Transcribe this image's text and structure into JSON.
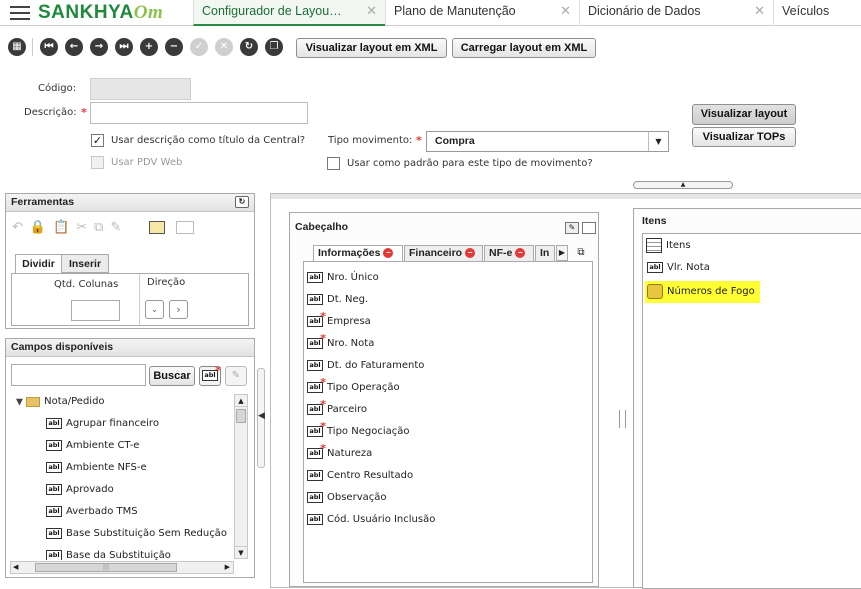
{
  "app": {
    "logo_text": "SANKHYA",
    "logo_suffix": "Om",
    "brand_color": "#1f8a3a"
  },
  "tabs": [
    {
      "label": "Configurador de Layou…",
      "active": true
    },
    {
      "label": "Plano de Manutenção"
    },
    {
      "label": "Dicionário de Dados"
    },
    {
      "label": "Veículos"
    }
  ],
  "toolbar": {
    "xml_view_label": "Visualizar layout em XML",
    "xml_load_label": "Carregar layout em XML"
  },
  "form": {
    "codigo_label": "Código:",
    "descricao_label": "Descrição:",
    "use_desc_label": "Usar descrição como título da Central?",
    "pdv_label": "Usar PDV Web",
    "tipo_mov_label": "Tipo movimento:",
    "tipo_mov_value": "Compra",
    "use_padrao_label": "Usar como padrão para este tipo de movimento?",
    "view_layout_label": "Visualizar layout",
    "view_tops_label": "Visualizar TOPs"
  },
  "ferramentas": {
    "title": "Ferramentas",
    "tab_dividir": "Dividir",
    "tab_inserir": "Inserir",
    "qtd_colunas_label": "Qtd. Colunas",
    "direcao_label": "Direção"
  },
  "campos": {
    "title": "Campos disponíveis",
    "buscar_label": "Buscar",
    "folder_label": "Nota/Pedido",
    "items": [
      "Agrupar financeiro",
      "Ambiente CT-e",
      "Ambiente NFS-e",
      "Aprovado",
      "Averbado TMS",
      "Base Substituição Sem Redução",
      "Base da Substituição"
    ]
  },
  "cabecalho": {
    "title": "Cabeçalho",
    "tabs": [
      "Informações",
      "Financeiro",
      "NF-e",
      "In"
    ],
    "fields": [
      {
        "label": "Nro. Único",
        "required": false
      },
      {
        "label": "Dt. Neg.",
        "required": false
      },
      {
        "label": "Empresa",
        "required": true
      },
      {
        "label": "Nro. Nota",
        "required": true
      },
      {
        "label": "Dt. do Faturamento",
        "required": false
      },
      {
        "label": "Tipo Operação",
        "required": true
      },
      {
        "label": "Parceiro",
        "required": true
      },
      {
        "label": "Tipo Negociação",
        "required": true
      },
      {
        "label": "Natureza",
        "required": true
      },
      {
        "label": "Centro Resultado",
        "required": false
      },
      {
        "label": "Observação",
        "required": false
      },
      {
        "label": "Cód. Usuário Inclusão",
        "required": false
      }
    ]
  },
  "itens": {
    "title": "Itens",
    "entries": [
      "Itens",
      "Vlr. Nota",
      "Números de Fogo"
    ],
    "highlight_color": "#ffff33"
  },
  "icons": {
    "field_icon_text": "abl"
  }
}
